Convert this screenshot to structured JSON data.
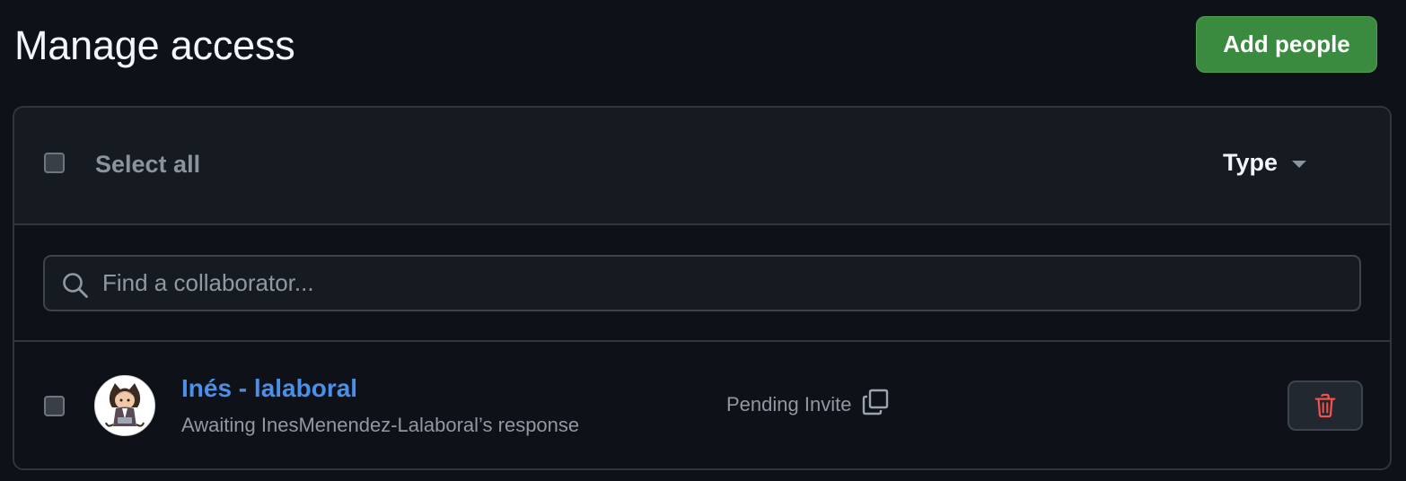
{
  "header": {
    "title": "Manage access",
    "add_button_label": "Add people"
  },
  "list_header": {
    "select_all_label": "Select all",
    "type_filter_label": "Type"
  },
  "search": {
    "placeholder": "Find a collaborator..."
  },
  "collaborators": [
    {
      "name": "Inés - lalaboral",
      "subtitle": "Awaiting InesMenendez-Lalaboral’s response",
      "status": "Pending Invite",
      "avatar_icon": "octocat-avatar-icon"
    }
  ],
  "colors": {
    "accent_green": "#3a8a3f",
    "link_blue": "#4c8fe8",
    "danger_red": "#f85149",
    "background": "#0e1117"
  },
  "icons": {
    "search": "search-icon",
    "dropdown": "caret-down-icon",
    "copy": "copy-icon",
    "delete": "trash-icon"
  }
}
